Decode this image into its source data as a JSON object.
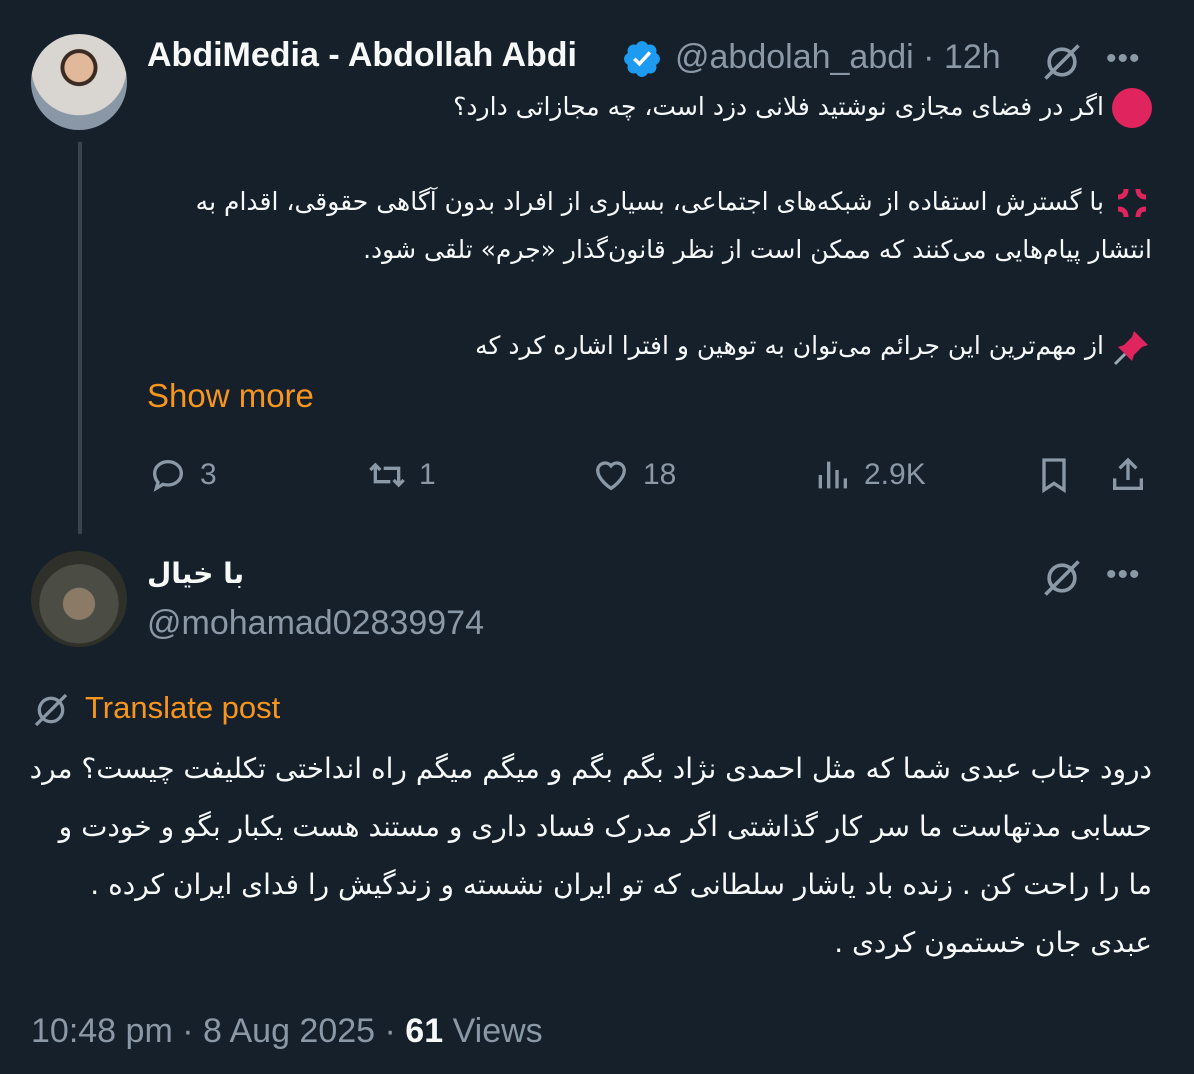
{
  "tweet": {
    "author_name": "AbdiMedia - Abdollah Abdi",
    "handle": "@abdolah_abdi",
    "separator": "·",
    "time": "12h",
    "paragraph1": "اگر در فضای مجازی نوشتید فلانی دزد است، چه مجازاتی دارد؟",
    "paragraph2": "با گسترش استفاده از شبکه‌های اجتماعی، بسیاری از افراد بدون آگاهی حقوقی، اقدام به انتشار پیام‌هایی می‌کنند که ممکن است از نظر قانون‌گذار «جرم» تلقی شود.",
    "paragraph3": "از مهم‌ترین این جرائم می‌توان به توهین و افترا اشاره کرد که",
    "show_more": "Show more",
    "stats": {
      "replies": "3",
      "reposts": "1",
      "likes": "18",
      "views": "2.9K"
    },
    "emojis": [
      "red-circle",
      "anger-symbol",
      "pushpin"
    ],
    "colors": {
      "accent": "#f7951d",
      "verified": "#1d9bf0",
      "emoji_red": "#e0245e"
    }
  },
  "reply": {
    "author_name": "با خیال",
    "handle": "@mohamad02839974",
    "translate_label": "Translate post",
    "body": "درود جناب عبدی شما که مثل احمدی نژاد بگم بگم و میگم میگم راه انداختی تکلیفت چیست؟ مرد حسابی مدتهاست ما سر کار گذاشتی اگر مدرک فساد داری و مستند هست یکبار بگو و خودت و ما را راحت کن . زنده باد یاشار سلطانی که تو ایران نشسته و زندگیش را فدای ایران کرده . عبدی جان خستمون کردی .",
    "time": "10:48 pm",
    "separator": "·",
    "date": "8 Aug 2025",
    "views_count": "61",
    "views_label": "Views"
  },
  "theme": {
    "background": "#15202b",
    "text": "#f7f9f9",
    "muted": "#8b98a5",
    "thread_line": "#38444d"
  }
}
